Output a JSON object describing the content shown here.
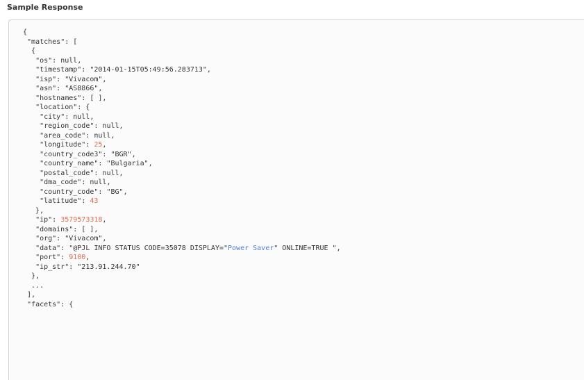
{
  "section_title": "Sample Response",
  "colors": {
    "number": "#e06c4c",
    "highlight": "#4d7fd3",
    "text": "#333333",
    "border": "#d6d6d6",
    "panel_background": "#fbfbfb"
  },
  "code_lines": [
    [
      {
        "t": "p",
        "v": "{"
      }
    ],
    [
      {
        "t": "p",
        "v": " "
      },
      {
        "t": "k",
        "v": "\"matches\""
      },
      {
        "t": "p",
        "v": ": ["
      }
    ],
    [
      {
        "t": "p",
        "v": "  {"
      }
    ],
    [
      {
        "t": "p",
        "v": "   "
      },
      {
        "t": "k",
        "v": "\"os\""
      },
      {
        "t": "p",
        "v": ": "
      },
      {
        "t": "lit",
        "v": "null"
      },
      {
        "t": "p",
        "v": ","
      }
    ],
    [
      {
        "t": "p",
        "v": "   "
      },
      {
        "t": "k",
        "v": "\"timestamp\""
      },
      {
        "t": "p",
        "v": ": "
      },
      {
        "t": "s",
        "v": "\"2014-01-15T05:49:56.283713\""
      },
      {
        "t": "p",
        "v": ","
      }
    ],
    [
      {
        "t": "p",
        "v": "   "
      },
      {
        "t": "k",
        "v": "\"isp\""
      },
      {
        "t": "p",
        "v": ": "
      },
      {
        "t": "s",
        "v": "\"Vivacom\""
      },
      {
        "t": "p",
        "v": ","
      }
    ],
    [
      {
        "t": "p",
        "v": "   "
      },
      {
        "t": "k",
        "v": "\"asn\""
      },
      {
        "t": "p",
        "v": ": "
      },
      {
        "t": "s",
        "v": "\"AS8866\""
      },
      {
        "t": "p",
        "v": ","
      }
    ],
    [
      {
        "t": "p",
        "v": "   "
      },
      {
        "t": "k",
        "v": "\"hostnames\""
      },
      {
        "t": "p",
        "v": ": [ ],"
      }
    ],
    [
      {
        "t": "p",
        "v": "   "
      },
      {
        "t": "k",
        "v": "\"location\""
      },
      {
        "t": "p",
        "v": ": {"
      }
    ],
    [
      {
        "t": "p",
        "v": "    "
      },
      {
        "t": "k",
        "v": "\"city\""
      },
      {
        "t": "p",
        "v": ": "
      },
      {
        "t": "lit",
        "v": "null"
      },
      {
        "t": "p",
        "v": ","
      }
    ],
    [
      {
        "t": "p",
        "v": "    "
      },
      {
        "t": "k",
        "v": "\"region_code\""
      },
      {
        "t": "p",
        "v": ": "
      },
      {
        "t": "lit",
        "v": "null"
      },
      {
        "t": "p",
        "v": ","
      }
    ],
    [
      {
        "t": "p",
        "v": "    "
      },
      {
        "t": "k",
        "v": "\"area_code\""
      },
      {
        "t": "p",
        "v": ": "
      },
      {
        "t": "lit",
        "v": "null"
      },
      {
        "t": "p",
        "v": ","
      }
    ],
    [
      {
        "t": "p",
        "v": "    "
      },
      {
        "t": "k",
        "v": "\"longitude\""
      },
      {
        "t": "p",
        "v": ": "
      },
      {
        "t": "n",
        "v": "25"
      },
      {
        "t": "p",
        "v": ","
      }
    ],
    [
      {
        "t": "p",
        "v": "    "
      },
      {
        "t": "k",
        "v": "\"country_code3\""
      },
      {
        "t": "p",
        "v": ": "
      },
      {
        "t": "s",
        "v": "\"BGR\""
      },
      {
        "t": "p",
        "v": ","
      }
    ],
    [
      {
        "t": "p",
        "v": "    "
      },
      {
        "t": "k",
        "v": "\"country_name\""
      },
      {
        "t": "p",
        "v": ": "
      },
      {
        "t": "s",
        "v": "\"Bulgaria\""
      },
      {
        "t": "p",
        "v": ","
      }
    ],
    [
      {
        "t": "p",
        "v": "    "
      },
      {
        "t": "k",
        "v": "\"postal_code\""
      },
      {
        "t": "p",
        "v": ": "
      },
      {
        "t": "lit",
        "v": "null"
      },
      {
        "t": "p",
        "v": ","
      }
    ],
    [
      {
        "t": "p",
        "v": "    "
      },
      {
        "t": "k",
        "v": "\"dma_code\""
      },
      {
        "t": "p",
        "v": ": "
      },
      {
        "t": "lit",
        "v": "null"
      },
      {
        "t": "p",
        "v": ","
      }
    ],
    [
      {
        "t": "p",
        "v": "    "
      },
      {
        "t": "k",
        "v": "\"country_code\""
      },
      {
        "t": "p",
        "v": ": "
      },
      {
        "t": "s",
        "v": "\"BG\""
      },
      {
        "t": "p",
        "v": ","
      }
    ],
    [
      {
        "t": "p",
        "v": "    "
      },
      {
        "t": "k",
        "v": "\"latitude\""
      },
      {
        "t": "p",
        "v": ": "
      },
      {
        "t": "n",
        "v": "43"
      }
    ],
    [
      {
        "t": "p",
        "v": "   },"
      }
    ],
    [
      {
        "t": "p",
        "v": "   "
      },
      {
        "t": "k",
        "v": "\"ip\""
      },
      {
        "t": "p",
        "v": ": "
      },
      {
        "t": "n",
        "v": "3579573318"
      },
      {
        "t": "p",
        "v": ","
      }
    ],
    [
      {
        "t": "p",
        "v": "   "
      },
      {
        "t": "k",
        "v": "\"domains\""
      },
      {
        "t": "p",
        "v": ": [ ],"
      }
    ],
    [
      {
        "t": "p",
        "v": "   "
      },
      {
        "t": "k",
        "v": "\"org\""
      },
      {
        "t": "p",
        "v": ": "
      },
      {
        "t": "s",
        "v": "\"Vivacom\""
      },
      {
        "t": "p",
        "v": ","
      }
    ],
    [
      {
        "t": "p",
        "v": "   "
      },
      {
        "t": "k",
        "v": "\"data\""
      },
      {
        "t": "p",
        "v": ": "
      },
      {
        "t": "s",
        "v": "\"@PJL INFO STATUS CODE=35078 DISPLAY=\""
      },
      {
        "t": "sh",
        "v": "Power Saver"
      },
      {
        "t": "s",
        "v": "\" ONLINE=TRUE \""
      },
      {
        "t": "p",
        "v": ","
      }
    ],
    [
      {
        "t": "p",
        "v": "   "
      },
      {
        "t": "k",
        "v": "\"port\""
      },
      {
        "t": "p",
        "v": ": "
      },
      {
        "t": "n",
        "v": "9100"
      },
      {
        "t": "p",
        "v": ","
      }
    ],
    [
      {
        "t": "p",
        "v": "   "
      },
      {
        "t": "k",
        "v": "\"ip_str\""
      },
      {
        "t": "p",
        "v": ": "
      },
      {
        "t": "s",
        "v": "\"213.91.244.70\""
      }
    ],
    [
      {
        "t": "p",
        "v": "  },"
      }
    ],
    [
      {
        "t": "p",
        "v": "  ..."
      }
    ],
    [
      {
        "t": "p",
        "v": " ],"
      }
    ],
    [
      {
        "t": "p",
        "v": " "
      },
      {
        "t": "k",
        "v": "\"facets\""
      },
      {
        "t": "p",
        "v": ": {"
      }
    ]
  ]
}
